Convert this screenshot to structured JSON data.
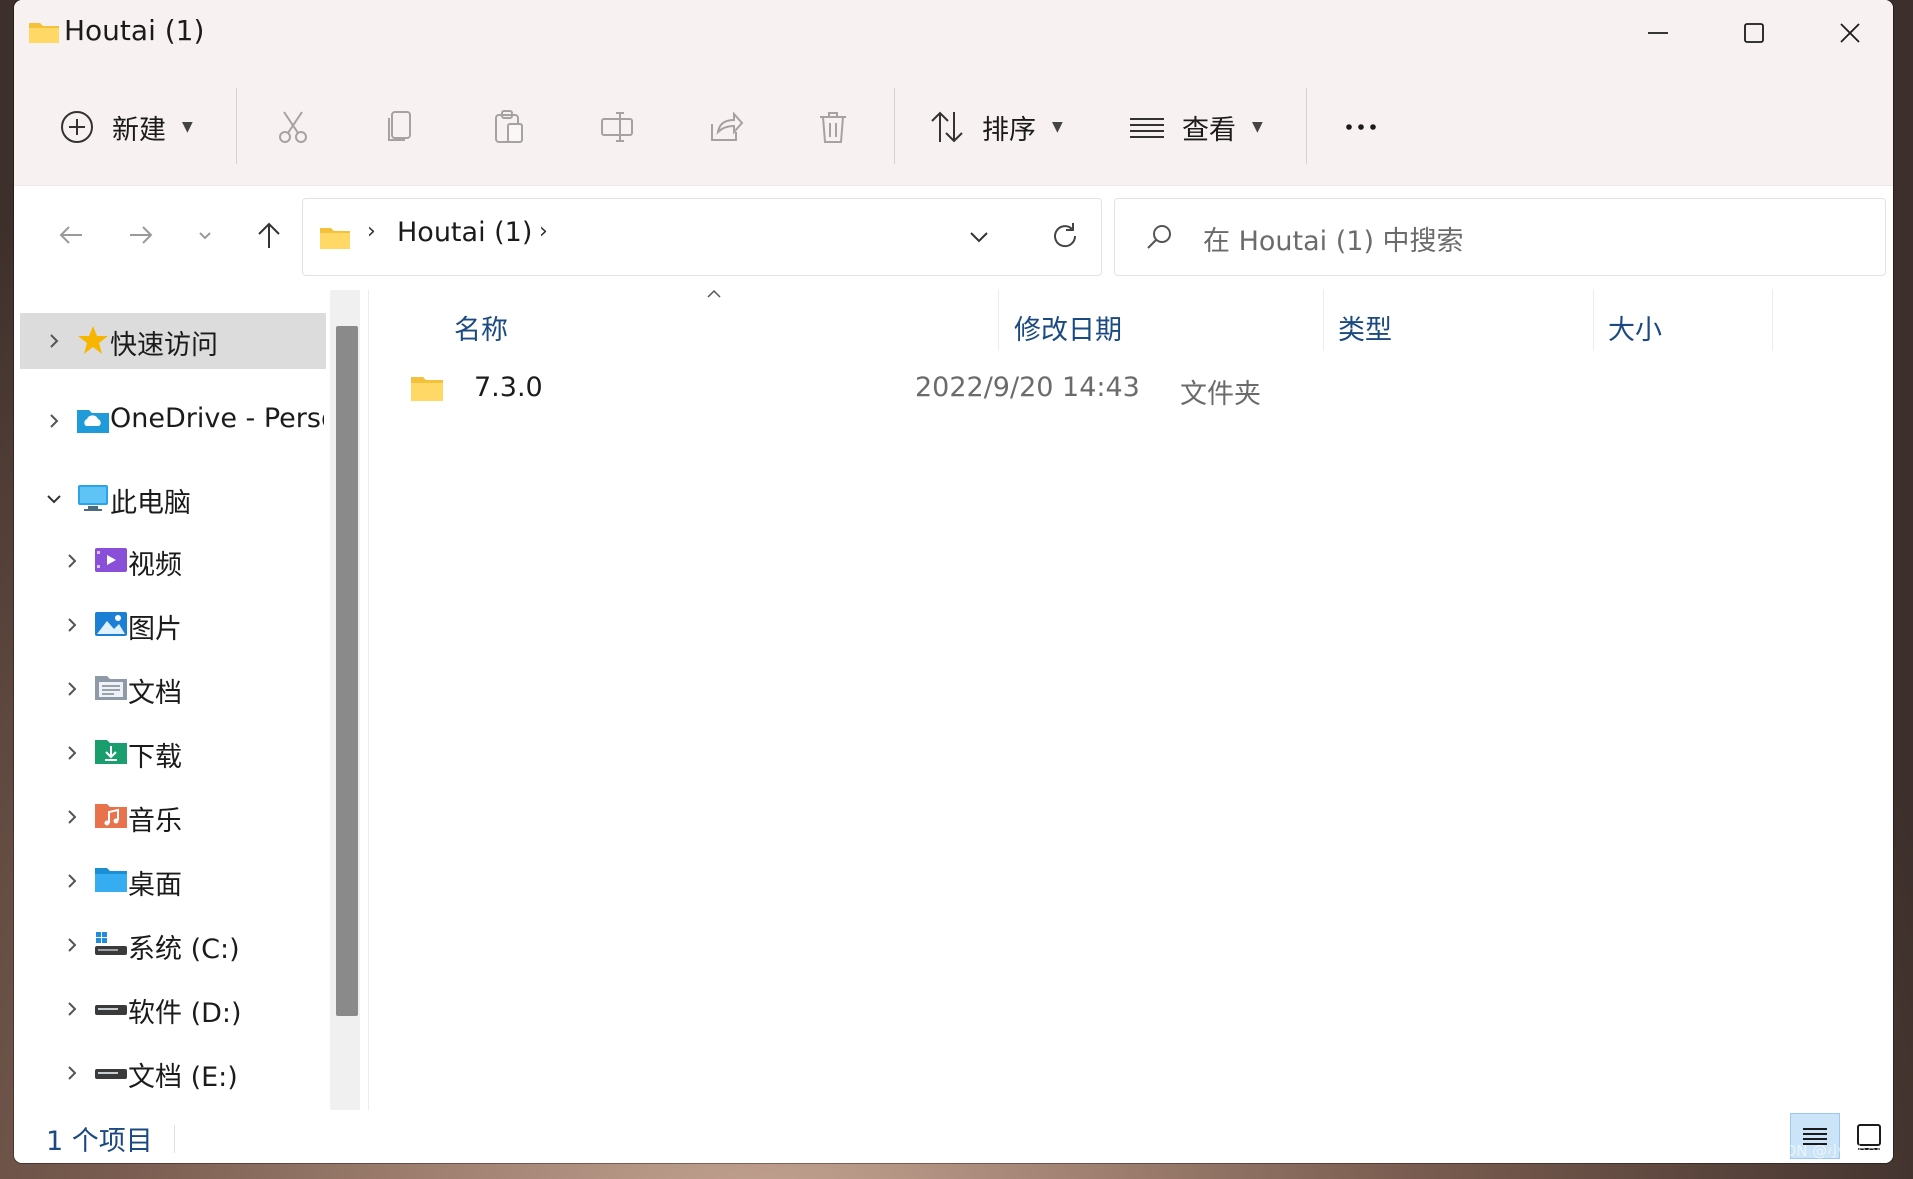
{
  "window": {
    "title": "Houtai (1)",
    "accent": "#0067c0",
    "titlebar_bg": "#f8f1f1"
  },
  "toolbar": {
    "new_label": "新建",
    "sort_label": "排序",
    "view_label": "查看",
    "more_icon": "more-icon"
  },
  "address": {
    "crumb": "Houtai (1)",
    "separator": "›"
  },
  "search": {
    "placeholder": "在 Houtai (1) 中搜索"
  },
  "sidebar": {
    "items": [
      {
        "label": "快速访问",
        "icon": "star-icon"
      },
      {
        "label": "OneDrive - Perso",
        "icon": "onedrive-icon"
      },
      {
        "label": "此电脑",
        "icon": "computer-icon"
      },
      {
        "label": "视频",
        "icon": "videos-icon"
      },
      {
        "label": "图片",
        "icon": "pictures-icon"
      },
      {
        "label": "文档",
        "icon": "documents-icon"
      },
      {
        "label": "下载",
        "icon": "downloads-icon"
      },
      {
        "label": "音乐",
        "icon": "music-icon"
      },
      {
        "label": "桌面",
        "icon": "desktop-icon"
      },
      {
        "label": "系统 (C:)",
        "icon": "drive-c-icon"
      },
      {
        "label": "软件 (D:)",
        "icon": "drive-d-icon"
      },
      {
        "label": "文档 (E:)",
        "icon": "drive-e-icon"
      }
    ]
  },
  "columns": {
    "name": "名称",
    "modified": "修改日期",
    "type": "类型",
    "size": "大小"
  },
  "files": [
    {
      "name": "7.3.0",
      "modified": "2022/9/20 14:43",
      "type": "文件夹",
      "size": ""
    }
  ],
  "status": {
    "count": "1 个项目"
  },
  "watermark": "CSDN @小新hero"
}
